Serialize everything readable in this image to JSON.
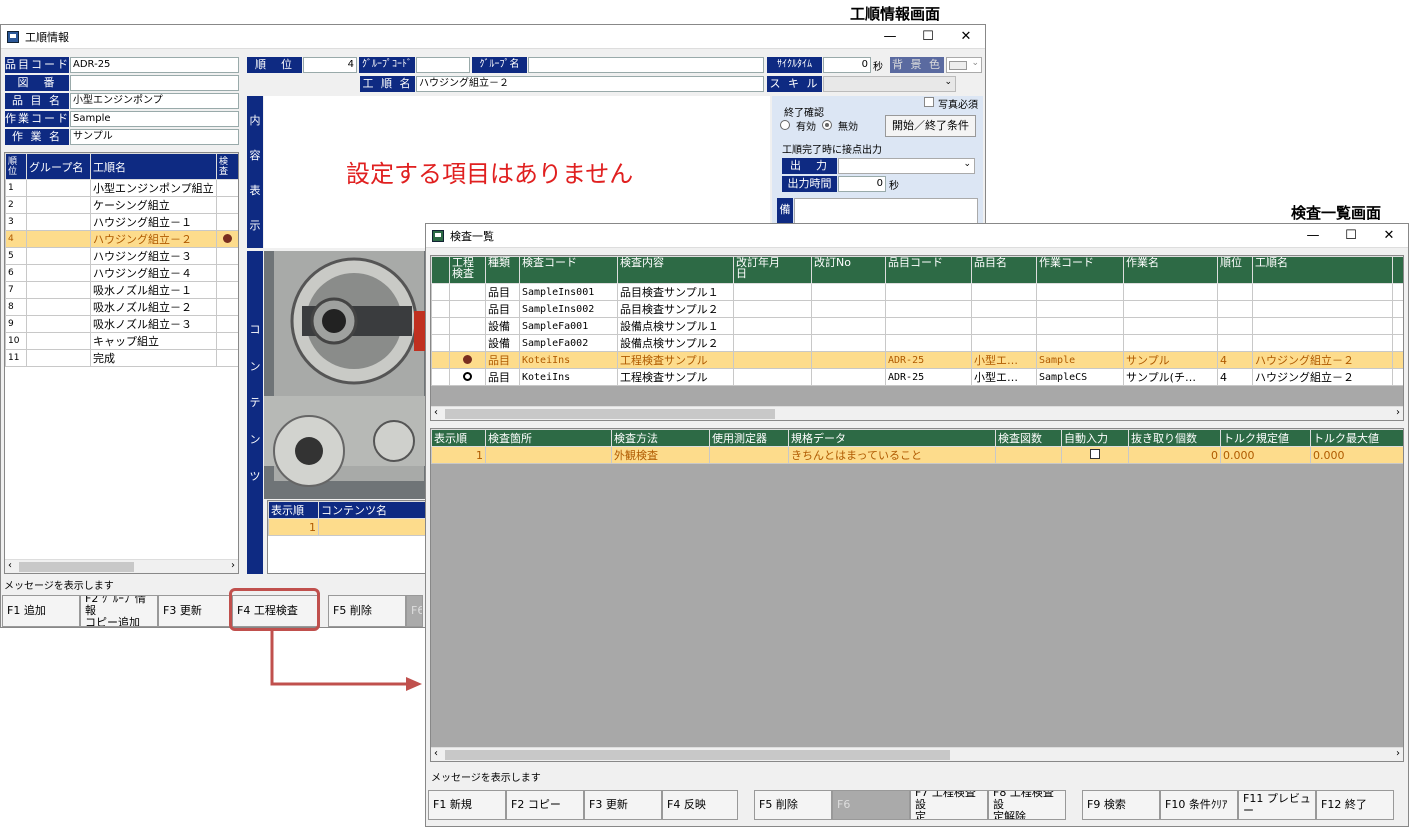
{
  "captions": {
    "koujun": "工順情報画面",
    "kensa": "検査一覧画面"
  },
  "koujun": {
    "title": "工順情報",
    "win_btns": [
      "—",
      "☐",
      "✕"
    ],
    "labels": {
      "hinmoku_code": "品目コード",
      "zuban": "図　番",
      "hinmoku_name": "品 目 名",
      "sagyo_code": "作業コード",
      "sagyo_name": "作 業 名",
      "juni": "順　位",
      "group_code": "ｸﾞﾙｰﾌﾟｺｰﾄﾞ",
      "group_name": "ｸﾞﾙｰﾌﾟ名",
      "koujun_name": "工 順 名",
      "cycle": "ｻｲｸﾙﾀｲﾑ",
      "bg_color": "背 景 色",
      "skill": "ス キ ル",
      "naiyou": [
        "内",
        "容",
        "表",
        "示"
      ],
      "contents": [
        "コ",
        "ン",
        "テ",
        "ン",
        "ツ"
      ]
    },
    "values": {
      "hinmoku_code": "ADR-25",
      "zuban": "",
      "hinmoku_name": "小型エンジンポンプ",
      "sagyo_code": "Sample",
      "sagyo_name": "サンプル",
      "juni": "4",
      "group_code": "",
      "group_name": "",
      "koujun_name": "ハウジング組立－２",
      "cycle": "0",
      "cycle_unit": "秒"
    },
    "photo_required": "写真必須",
    "end_confirm": "終了確認",
    "radio_enabled": "有効",
    "radio_disabled": "無効",
    "start_end_btn": "開始／終了条件",
    "output_title": "工順完了時に接点出力",
    "output_label": "出　力",
    "output_time_label": "出力時間",
    "output_time_value": "0",
    "output_time_unit": "秒",
    "bikou": "備",
    "no_items": "設定する項目はありません",
    "list_headers": [
      "順位",
      "グループ名",
      "工順名",
      "検査"
    ],
    "list_rows": [
      {
        "no": "1",
        "group": "",
        "name": "小型エンジンポンプ組立",
        "k": ""
      },
      {
        "no": "2",
        "group": "",
        "name": "ケーシング組立",
        "k": ""
      },
      {
        "no": "3",
        "group": "",
        "name": "ハウジング組立－１",
        "k": ""
      },
      {
        "no": "4",
        "group": "",
        "name": "ハウジング組立－２",
        "k": "dot"
      },
      {
        "no": "5",
        "group": "",
        "name": "ハウジング組立－３",
        "k": ""
      },
      {
        "no": "6",
        "group": "",
        "name": "ハウジング組立－４",
        "k": ""
      },
      {
        "no": "7",
        "group": "",
        "name": "吸水ノズル組立－１",
        "k": ""
      },
      {
        "no": "8",
        "group": "",
        "name": "吸水ノズル組立－２",
        "k": ""
      },
      {
        "no": "9",
        "group": "",
        "name": "吸水ノズル組立－３",
        "k": ""
      },
      {
        "no": "10",
        "group": "",
        "name": "キャップ組立",
        "k": ""
      },
      {
        "no": "11",
        "group": "",
        "name": "完成",
        "k": ""
      }
    ],
    "contents_headers": [
      "表示順",
      "コンテンツ名"
    ],
    "contents_rows": [
      {
        "no": "1",
        "name": ""
      }
    ],
    "message": "メッセージを表示します",
    "fkeys": [
      "F1 追加",
      "F2 ｸﾞﾙｰﾌﾟ情報\nコピー追加",
      "F3 更新",
      "F4 工程検査",
      "F5 削除",
      "F6"
    ]
  },
  "kensa": {
    "title": "検査一覧",
    "win_btns": [
      "—",
      "☐",
      "✕"
    ],
    "headers": [
      "工程\n検査",
      "種類",
      "検査コード",
      "検査内容",
      "改訂年月\n日",
      "改訂No",
      "品目コード",
      "品目名",
      "作業コード",
      "作業名",
      "順位",
      "工順名"
    ],
    "rows": [
      {
        "mark": "",
        "kind": "品目",
        "code": "SampleIns001",
        "content": "品目検査サンプル１",
        "date": "",
        "rev": "",
        "hcode": "",
        "hname": "",
        "scode": "",
        "sname": "",
        "juni": "",
        "kname": ""
      },
      {
        "mark": "",
        "kind": "品目",
        "code": "SampleIns002",
        "content": "品目検査サンプル２",
        "date": "",
        "rev": "",
        "hcode": "",
        "hname": "",
        "scode": "",
        "sname": "",
        "juni": "",
        "kname": ""
      },
      {
        "mark": "",
        "kind": "設備",
        "code": "SampleFa001",
        "content": "設備点検サンプル１",
        "date": "",
        "rev": "",
        "hcode": "",
        "hname": "",
        "scode": "",
        "sname": "",
        "juni": "",
        "kname": ""
      },
      {
        "mark": "",
        "kind": "設備",
        "code": "SampleFa002",
        "content": "設備点検サンプル２",
        "date": "",
        "rev": "",
        "hcode": "",
        "hname": "",
        "scode": "",
        "sname": "",
        "juni": "",
        "kname": ""
      },
      {
        "mark": "dot",
        "kind": "品目",
        "code": "KoteiIns",
        "content": "工程検査サンプル",
        "date": "",
        "rev": "",
        "hcode": "ADR-25",
        "hname": "小型エ…",
        "scode": "Sample",
        "sname": "サンプル",
        "juni": "4",
        "kname": "ハウジング組立－２"
      },
      {
        "mark": "odot",
        "kind": "品目",
        "code": "KoteiIns",
        "content": "工程検査サンプル",
        "date": "",
        "rev": "",
        "hcode": "ADR-25",
        "hname": "小型エ…",
        "scode": "SampleCS",
        "sname": "サンプル(チ…",
        "juni": "4",
        "kname": "ハウジング組立－２"
      }
    ],
    "detail_headers": [
      "表示順",
      "検査箇所",
      "検査方法",
      "使用測定器",
      "規格データ",
      "検査図数",
      "自動入力",
      "抜き取り個数",
      "トルク規定値",
      "トルク最大値"
    ],
    "detail_rows": [
      {
        "no": "1",
        "place": "",
        "method": "外観検査",
        "tool": "",
        "spec": "きちんとはまっていること",
        "zu": "",
        "auto": "",
        "count": "0",
        "tq": "0.000",
        "tqmax": "0.000"
      }
    ],
    "message": "メッセージを表示します",
    "fkeys": [
      "F1 新規",
      "F2 コピー",
      "F3 更新",
      "F4 反映",
      "F5 削除",
      "F6",
      "F7 工程検査設\n定",
      "F8 工程検査設\n定解除",
      "F9 検索",
      "F10 条件ｸﾘｱ",
      "F11 プレビュー",
      "F12 終了"
    ]
  },
  "colors": {
    "label_bg": "#0e2a82",
    "grid_header": "#2d6a45",
    "selected_row": "#fddc8c",
    "annotation_red": "#e02020",
    "highlight": "#c0504d"
  }
}
